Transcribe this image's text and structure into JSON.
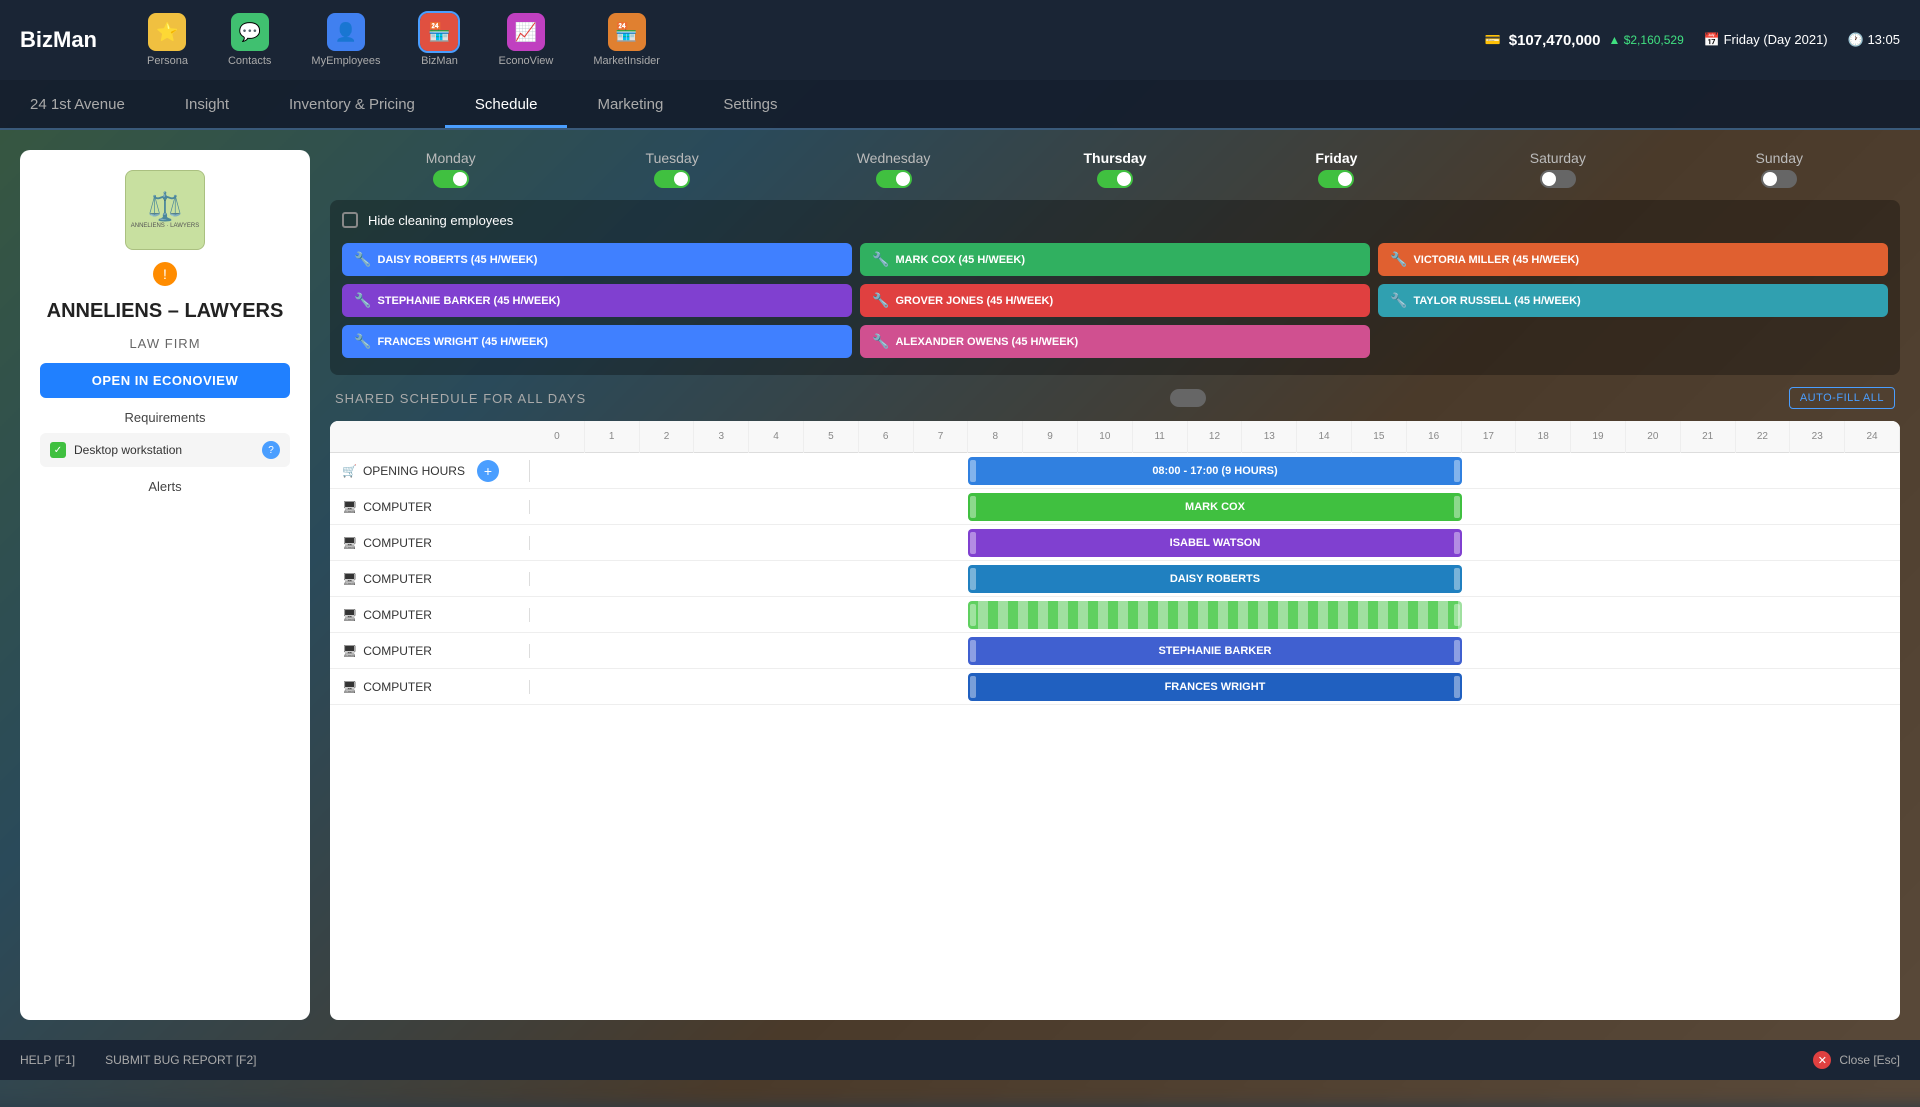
{
  "app": {
    "logo": "BizMan",
    "money": "$107,470,000",
    "money_change": "▲ $2,160,529",
    "date": "Friday (Day 2021)",
    "time": "13:05"
  },
  "nav_apps": [
    {
      "label": "Persona",
      "icon": "⭐",
      "color": "#f0c040",
      "active": false
    },
    {
      "label": "Contacts",
      "icon": "💬",
      "color": "#40c070",
      "active": false
    },
    {
      "label": "MyEmployees",
      "icon": "👤",
      "color": "#4080f0",
      "active": false
    },
    {
      "label": "BizMan",
      "icon": "🏪",
      "color": "#e05040",
      "active": true
    },
    {
      "label": "EconoView",
      "icon": "📈",
      "color": "#c040c0",
      "active": false
    },
    {
      "label": "MarketInsider",
      "icon": "🏪",
      "color": "#e08030",
      "active": false
    }
  ],
  "second_nav": [
    {
      "label": "24 1st Avenue",
      "active": false
    },
    {
      "label": "Insight",
      "active": false
    },
    {
      "label": "Inventory & Pricing",
      "active": false
    },
    {
      "label": "Schedule",
      "active": true
    },
    {
      "label": "Marketing",
      "active": false
    },
    {
      "label": "Settings",
      "active": false
    }
  ],
  "left_panel": {
    "company_name": "ANNELIENS – LAWYERS",
    "company_type": "LAW FIRM",
    "open_btn": "OPEN IN ECONOVIEW",
    "requirements_title": "Requirements",
    "requirement_item": "Desktop workstation",
    "alerts_title": "Alerts"
  },
  "days": [
    {
      "label": "Monday",
      "state": "on"
    },
    {
      "label": "Tuesday",
      "state": "on"
    },
    {
      "label": "Wednesday",
      "state": "on"
    },
    {
      "label": "Thursday",
      "state": "on",
      "active": true
    },
    {
      "label": "Friday",
      "state": "on",
      "active": true
    },
    {
      "label": "Saturday",
      "state": "off"
    },
    {
      "label": "Sunday",
      "state": "off"
    }
  ],
  "hide_cleaning": "Hide cleaning employees",
  "employees": [
    {
      "name": "DAISY ROBERTS (45 H/WEEK)",
      "color": "blue"
    },
    {
      "name": "MARK COX (45 H/WEEK)",
      "color": "green"
    },
    {
      "name": "VICTORIA MILLER (45 H/WEEK)",
      "color": "orange"
    },
    {
      "name": "STEPHANIE BARKER (45 H/WEEK)",
      "color": "purple"
    },
    {
      "name": "GROVER JONES (45 H/WEEK)",
      "color": "green"
    },
    {
      "name": "TAYLOR RUSSELL (45 H/WEEK)",
      "color": "teal"
    },
    {
      "name": "FRANCES WRIGHT (45 H/WEEK)",
      "color": "blue"
    },
    {
      "name": "ALEXANDER OWENS (45 H/WEEK)",
      "color": "pink"
    }
  ],
  "shared_schedule_label": "SHARED SCHEDULE FOR ALL DAYS",
  "auto_fill_btn": "AUTO-FILL ALL",
  "schedule_hours": [
    0,
    1,
    2,
    3,
    4,
    5,
    6,
    7,
    8,
    9,
    10,
    11,
    12,
    13,
    14,
    15,
    16,
    17,
    18,
    19,
    20,
    21,
    22,
    23,
    24
  ],
  "schedule_rows": [
    {
      "type": "opening",
      "label": "OPENING HOURS",
      "bar_text": "08:00 - 17:00 (9 HOURS)",
      "bar_color": "bar-opening"
    },
    {
      "type": "computer",
      "label": "COMPUTER",
      "bar_text": "MARK COX",
      "bar_color": "bar-mark"
    },
    {
      "type": "computer",
      "label": "COMPUTER",
      "bar_text": "ISABEL WATSON",
      "bar_color": "bar-isabel"
    },
    {
      "type": "computer",
      "label": "COMPUTER",
      "bar_text": "DAISY ROBERTS",
      "bar_color": "bar-daisy"
    },
    {
      "type": "computer",
      "label": "COMPUTER",
      "bar_text": "",
      "bar_color": "bar-green-pattern"
    },
    {
      "type": "computer",
      "label": "COMPUTER",
      "bar_text": "STEPHANIE BARKER",
      "bar_color": "bar-stephanie"
    },
    {
      "type": "computer",
      "label": "COMPUTER",
      "bar_text": "FRANCES WRIGHT",
      "bar_color": "bar-frances"
    }
  ],
  "bottom": {
    "help": "HELP [F1]",
    "bug": "SUBMIT BUG REPORT [F2]",
    "close": "Close [Esc]"
  }
}
